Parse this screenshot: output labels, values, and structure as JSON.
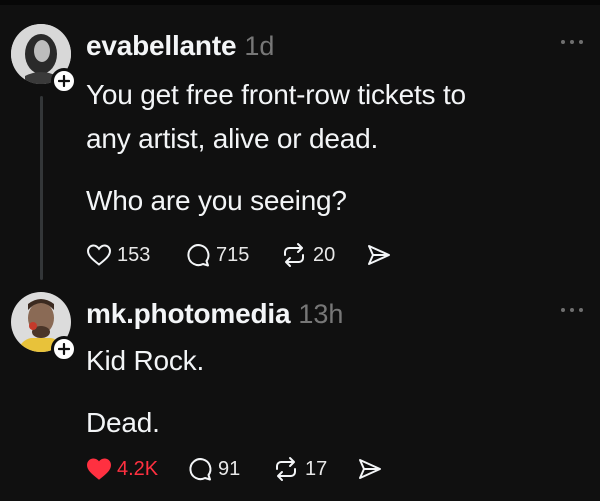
{
  "posts": [
    {
      "username": "evabellante",
      "time": "1d",
      "lines": [
        "You get free front-row tickets to",
        "any artist, alive or dead.",
        "Who are you seeing?"
      ],
      "likes": "153",
      "replies": "715",
      "reposts": "20",
      "liked": false
    },
    {
      "username": "mk.photomedia",
      "time": "13h",
      "lines": [
        "Kid Rock.",
        "Dead."
      ],
      "likes": "4.2K",
      "replies": "91",
      "reposts": "17",
      "liked": true
    }
  ],
  "colors": {
    "background": "#101010",
    "text": "#f3f5f7",
    "muted": "#777777",
    "like_active": "#ff3040"
  }
}
